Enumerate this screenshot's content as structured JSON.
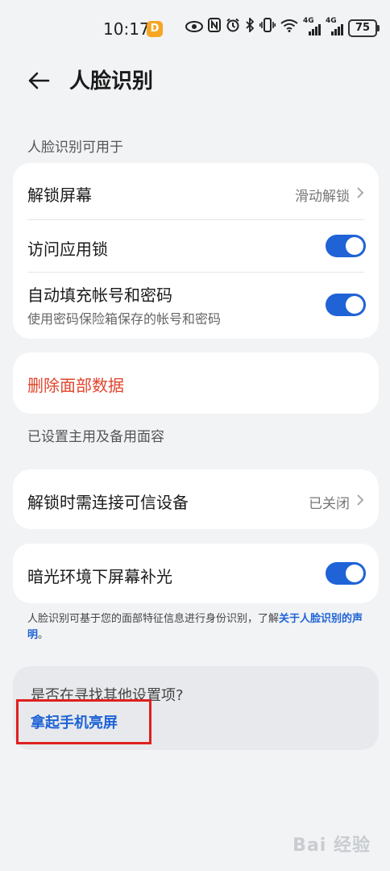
{
  "status_bar": {
    "time": "10:17",
    "notification_badge": "D",
    "network_1": "4G",
    "network_2": "4G",
    "battery": "75"
  },
  "header": {
    "title": "人脸识别"
  },
  "section1": {
    "label": "人脸识别可用于",
    "unlock_screen": {
      "title": "解锁屏幕",
      "value": "滑动解锁"
    },
    "app_lock": {
      "title": "访问应用锁",
      "enabled": true
    },
    "autofill": {
      "title": "自动填充帐号和密码",
      "subtitle": "使用密码保险箱保存的帐号和密码",
      "enabled": true
    }
  },
  "delete_face": {
    "label": "删除面部数据"
  },
  "section2": {
    "label": "已设置主用及备用面容"
  },
  "trusted_device": {
    "title": "解锁时需连接可信设备",
    "value": "已关闭"
  },
  "low_light": {
    "title": "暗光环境下屏幕补光",
    "enabled": true
  },
  "footnote": {
    "text": "人脸识别可基于您的面部特征信息进行身份识别，了解",
    "link": "关于人脸识别的声明",
    "end": "。"
  },
  "suggest": {
    "title": "是否在寻找其他设置项?",
    "link": "拿起手机亮屏"
  },
  "watermark": "Bai 经验",
  "colors": {
    "accent": "#1f63d6",
    "danger": "#e0452c",
    "highlight": "#e0201e",
    "background": "#f1f3f5"
  }
}
